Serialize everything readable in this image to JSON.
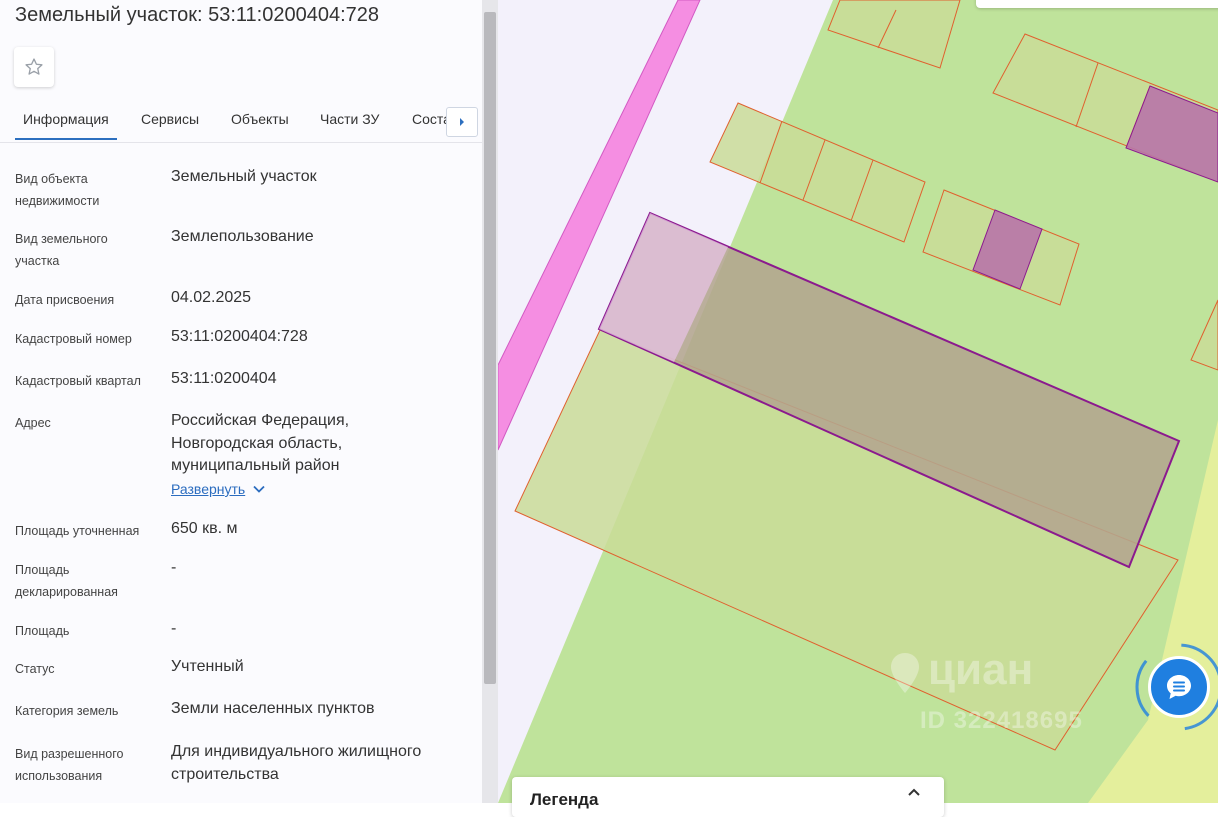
{
  "panel": {
    "title": "Земельный участок: 53:11:0200404:728",
    "tabs": [
      {
        "label": "Информация"
      },
      {
        "label": "Сервисы"
      },
      {
        "label": "Объекты"
      },
      {
        "label": "Части ЗУ"
      },
      {
        "label": "Соста"
      }
    ],
    "fields": [
      {
        "label": "Вид объекта недвижимости",
        "value": "Земельный участок"
      },
      {
        "label": "Вид земельного участка",
        "value": "Землепользование"
      },
      {
        "label": "Дата присвоения",
        "value": "04.02.2025"
      },
      {
        "label": "Кадастровый номер",
        "value": "53:11:0200404:728"
      },
      {
        "label": "Кадастровый квартал",
        "value": "53:11:0200404"
      },
      {
        "label": "Адрес",
        "value": "Российская Федерация, Новгородская область, муниципальный район"
      },
      {
        "label": "Площадь уточненная",
        "value": "650 кв. м"
      },
      {
        "label": "Площадь декларированная",
        "value": "-"
      },
      {
        "label": "Площадь",
        "value": "-"
      },
      {
        "label": "Статус",
        "value": "Учтенный"
      },
      {
        "label": "Категория земель",
        "value": "Земли населенных пунктов"
      },
      {
        "label": "Вид разрешенного использования",
        "value": "Для индивидуального жилищного строительства"
      }
    ],
    "expand_label": "Развернуть"
  },
  "map": {
    "legend_label": "Легенда",
    "watermark_text": "циан",
    "watermark_id": "ID 322418695"
  },
  "icons": {
    "favorite": "star-icon",
    "tabs_next": "caret-right-icon",
    "expand": "chevron-down-icon",
    "legend_toggle": "chevron-up-icon",
    "chat": "chat-icon"
  },
  "colors": {
    "accent": "#2c6fbf",
    "land_green": "#bfe39b",
    "selected_parcel": "#8b1a8e",
    "parcel_outline": "#e0602e",
    "road_pink": "#f56fe0",
    "chat_button": "#1f7fe0"
  }
}
